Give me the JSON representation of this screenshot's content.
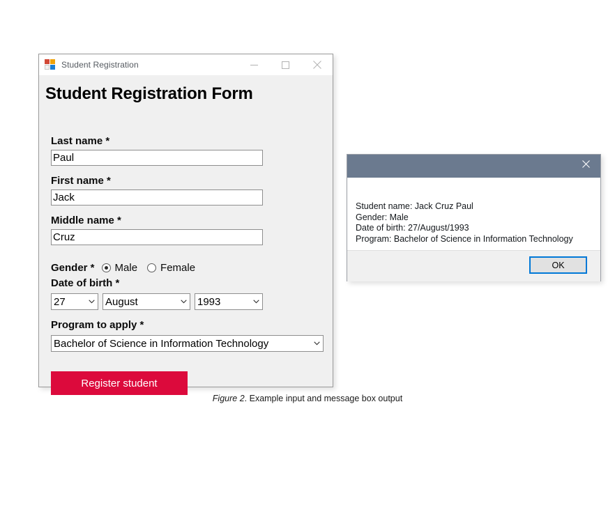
{
  "window": {
    "title": "Student Registration",
    "icon": "winforms-app-icon",
    "caption_buttons": [
      {
        "name": "minimize",
        "glyph": "minimize-icon"
      },
      {
        "name": "maximize",
        "glyph": "maximize-icon"
      },
      {
        "name": "close",
        "glyph": "close-icon"
      }
    ]
  },
  "form": {
    "heading": "Student Registration Form",
    "fields": {
      "last_name": {
        "label": "Last name *",
        "value": "Paul",
        "placeholder": ""
      },
      "first_name": {
        "label": "First name *",
        "value": "Jack",
        "placeholder": ""
      },
      "middle_name": {
        "label": "Middle name *",
        "value": "Cruz",
        "placeholder": ""
      }
    },
    "gender": {
      "label": "Gender *",
      "options": [
        "Male",
        "Female"
      ],
      "selected": "Male"
    },
    "date_of_birth": {
      "label": "Date of birth *",
      "day": "27",
      "month": "August",
      "year": "1993"
    },
    "program": {
      "label": "Program to apply *",
      "value": "Bachelor of Science in Information Technology"
    },
    "submit_button": {
      "label": "Register student",
      "color": "#dc0a3c"
    }
  },
  "dialog": {
    "titlebar_color": "#6b7a8f",
    "close_glyph": "close-icon",
    "message": "Student name: Jack Cruz Paul\nGender: Male\nDate of birth: 27/August/1993\nProgram: Bachelor of Science in Information Technology",
    "ok_button": "OK",
    "accent_color": "#0078d7"
  },
  "caption": {
    "figure_number": "Figure 2",
    "text": ". Example input and message box output"
  }
}
